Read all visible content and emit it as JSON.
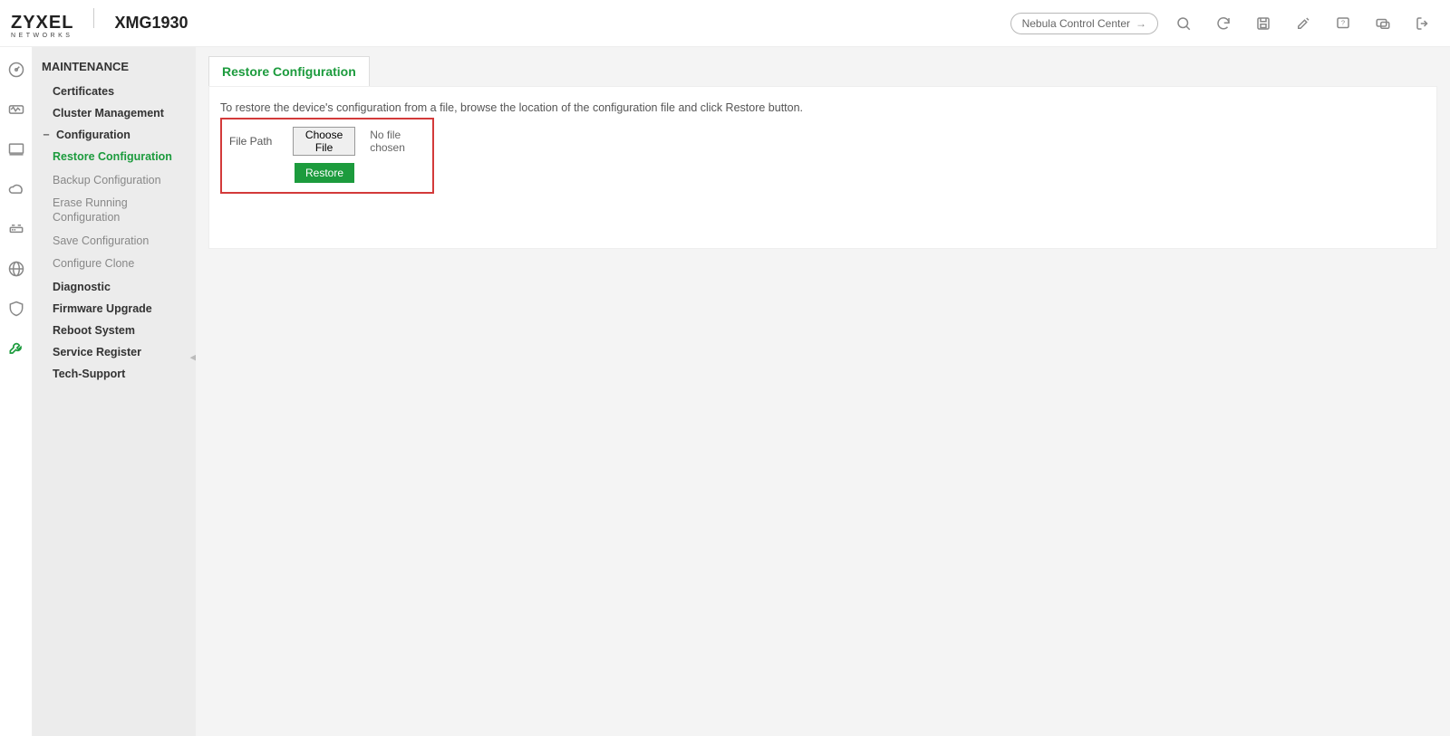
{
  "brand": {
    "main": "ZYXEL",
    "sub": "NETWORKS"
  },
  "model": "XMG1930",
  "ncc_label": "Nebula Control Center",
  "top_icons": [
    "search-icon",
    "refresh-icon",
    "save-icon",
    "tools-icon",
    "help-icon",
    "forum-icon",
    "logout-icon"
  ],
  "rail_icons": [
    "dashboard-icon",
    "monitor-icon",
    "system-icon",
    "cloud-icon",
    "switching-icon",
    "networking-icon",
    "security-icon",
    "maintenance-icon"
  ],
  "sidebar": {
    "title": "MAINTENANCE",
    "items": [
      {
        "label": "Certificates",
        "type": "item"
      },
      {
        "label": "Cluster Management",
        "type": "item"
      },
      {
        "label": "Configuration",
        "type": "expander",
        "open": true,
        "children": [
          {
            "label": "Restore Configuration",
            "active": true
          },
          {
            "label": "Backup Configuration"
          },
          {
            "label": "Erase Running Configuration"
          },
          {
            "label": "Save Configuration"
          },
          {
            "label": "Configure Clone"
          }
        ]
      },
      {
        "label": "Diagnostic",
        "type": "item"
      },
      {
        "label": "Firmware Upgrade",
        "type": "item"
      },
      {
        "label": "Reboot System",
        "type": "item"
      },
      {
        "label": "Service Register",
        "type": "item"
      },
      {
        "label": "Tech-Support",
        "type": "item"
      }
    ]
  },
  "tab_label": "Restore Configuration",
  "instruction": "To restore the device's configuration from a file, browse the location of the configuration file and click Restore button.",
  "form": {
    "file_path_label": "File Path",
    "choose_file_label": "Choose File",
    "file_status": "No file chosen",
    "restore_label": "Restore"
  }
}
